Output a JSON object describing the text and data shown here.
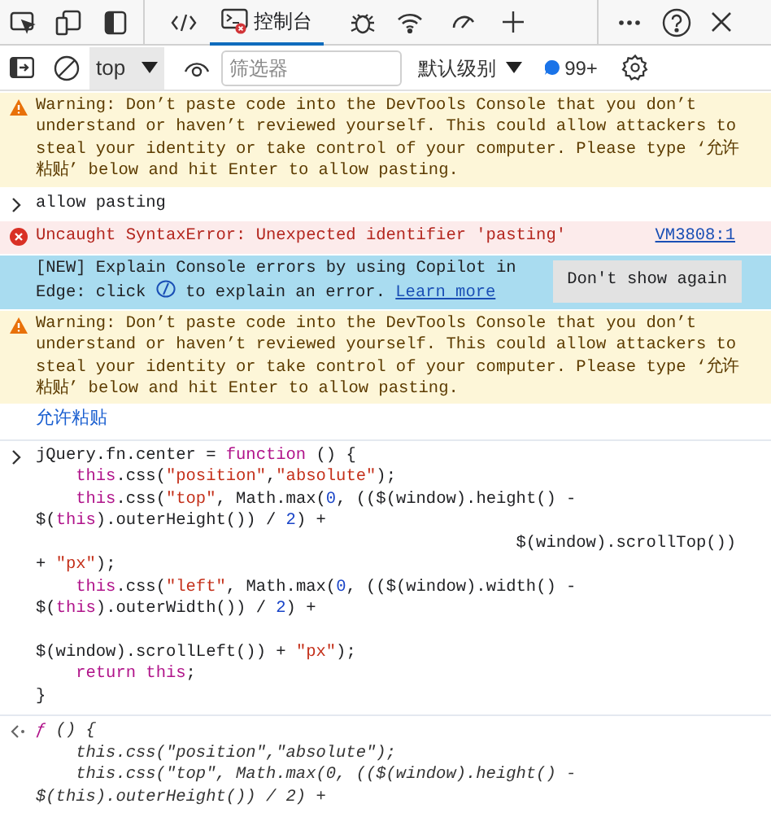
{
  "tabs": [
    {
      "label": "控制台",
      "selected": true,
      "error_badge": true
    }
  ],
  "filter_bar": {
    "context": "top",
    "placeholder": "筛选器",
    "levels": "默认级别",
    "issues_count": "99+"
  },
  "messages": [
    {
      "kind": "warning",
      "text": "Warning: Don’t paste code into the DevTools Console that you don’t understand or haven’t reviewed yourself. This could allow attackers to steal your identity or take control of your computer. Please type ‘允许粘贴’ below and hit Enter to allow pasting."
    },
    {
      "kind": "input",
      "text": "allow pasting"
    },
    {
      "kind": "error",
      "text": "Uncaught SyntaxError: Unexpected identifier 'pasting'",
      "source": "VM3808:1"
    },
    {
      "kind": "info",
      "text_before": "[NEW] Explain Console errors by using Copilot in Edge: click",
      "text_after": "to explain an error.",
      "link": "Learn more",
      "button": "Don't show again"
    },
    {
      "kind": "warning",
      "text": "Warning: Don’t paste code into the DevTools Console that you don’t understand or haven’t reviewed yourself. This could allow attackers to steal your identity or take control of your computer. Please type ‘允许粘贴’ below and hit Enter to allow pasting."
    },
    {
      "kind": "link",
      "text": "允许粘贴"
    },
    {
      "kind": "code_input",
      "lines": [
        {
          "text": "jQuery.fn.center = function () {",
          "gap_before": false
        },
        {
          "text": "    this.css(\"position\",\"absolute\");",
          "gap_before": false
        },
        {
          "text": "    this.css(\"top\", Math.max(0, (($(window).height() -",
          "gap_before": false
        },
        {
          "text": "$(this).outerHeight()) / 2) +",
          "gap_before": false
        },
        {
          "text": "                                                $(window).scrollTop())",
          "gap_before": false
        },
        {
          "text": "+ \"px\");",
          "gap_before": false
        },
        {
          "text": "    this.css(\"left\", Math.max(0, (($(window).width() -",
          "gap_before": false
        },
        {
          "text": "$(this).outerWidth()) / 2) +",
          "gap_before": false
        },
        {
          "text": "$(window).scrollLeft()) + \"px\");",
          "gap_before": true
        },
        {
          "text": "    return this;",
          "gap_before": false
        },
        {
          "text": "}",
          "gap_before": false
        }
      ]
    },
    {
      "kind": "code_result",
      "lines": [
        {
          "text": "ƒ () {",
          "gap_before": false
        },
        {
          "text": "    this.css(\"position\",\"absolute\");",
          "gap_before": false
        },
        {
          "text": "    this.css(\"top\", Math.max(0, (($(window).height() -",
          "gap_before": false
        },
        {
          "text": "$(this).outerHeight()) / 2) +",
          "gap_before": false
        }
      ]
    }
  ]
}
